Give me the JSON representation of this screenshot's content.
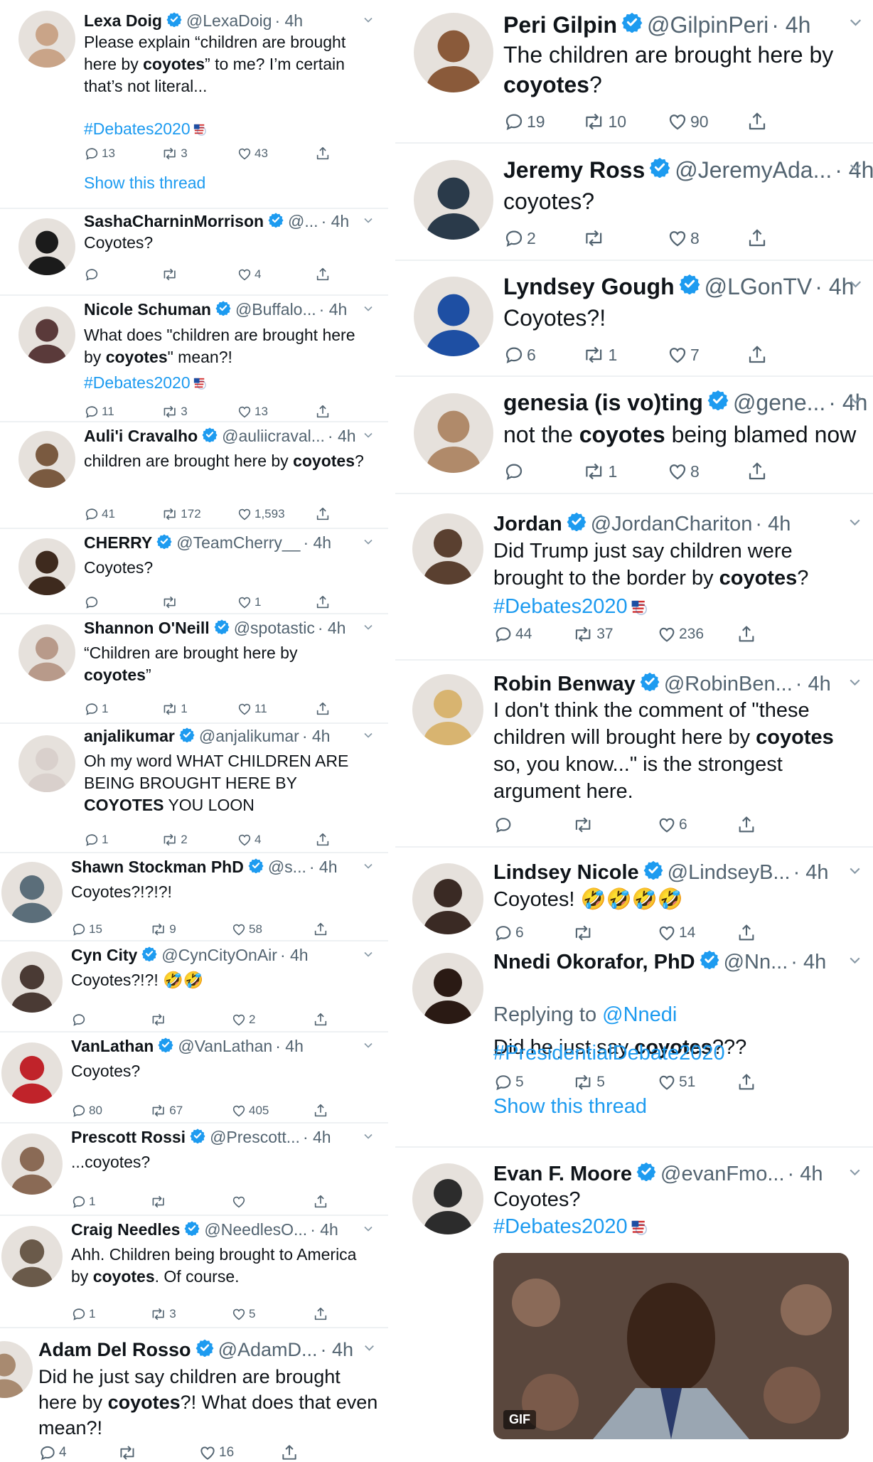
{
  "left": [
    {
      "name": "Lexa Doig",
      "handle": "@LexaDoig",
      "time": "· 4h",
      "pre": "Please explain “children are brought here by ",
      "bold": "coyotes",
      "post": "” to me?  I’m certain that’s not literal...",
      "hashtag": "#Debates2020",
      "reply": "13",
      "rt": "3",
      "like": "43",
      "show": "Show this thread"
    },
    {
      "name": "SashaCharninMorrison",
      "handle": "@...",
      "time": "· 4h",
      "pre": "Coyotes?",
      "bold": "",
      "post": "",
      "reply": "",
      "rt": "",
      "like": "4"
    },
    {
      "name": "Nicole Schuman",
      "handle": "@Buffalo...",
      "time": "· 4h",
      "pre": "What does \"children are brought here by ",
      "bold": "coyotes",
      "post": "\" mean?!",
      "hashtag": "#Debates2020",
      "reply": "11",
      "rt": "3",
      "like": "13"
    },
    {
      "name": "Auli'i Cravalho",
      "handle": "@auliicraval...",
      "time": "· 4h",
      "pre": "children are brought here by ",
      "bold": "coyotes",
      "post": "?",
      "reply": "41",
      "rt": "172",
      "like": "1,593"
    },
    {
      "name": "CHERRY",
      "handle": "@TeamCherry__",
      "time": "· 4h",
      "pre": "Coyotes?",
      "bold": "",
      "post": "",
      "reply": "",
      "rt": "",
      "like": "1"
    },
    {
      "name": "Shannon O'Neill",
      "handle": "@spotastic",
      "time": "· 4h",
      "pre": "“Children are brought here by ",
      "bold": "coyotes",
      "post": "”",
      "reply": "1",
      "rt": "1",
      "like": "11"
    },
    {
      "name": "anjalikumar",
      "handle": "@anjalikumar",
      "time": "· 4h",
      "pre": "Oh my word WHAT CHILDREN ARE BEING BROUGHT HERE BY ",
      "bold": "COYOTES",
      "post": " YOU LOON",
      "reply": "1",
      "rt": "2",
      "like": "4"
    },
    {
      "name": "Shawn Stockman PhD",
      "handle": "@s...",
      "time": "· 4h",
      "pre": "Coyotes?!?!?!",
      "bold": "",
      "post": "",
      "reply": "15",
      "rt": "9",
      "like": "58"
    },
    {
      "name": "Cyn City",
      "handle": "@CynCityOnAir",
      "time": "· 4h",
      "pre": "Coyotes?!?! ",
      "bold": "",
      "post": "",
      "emoji": "🤣🤣",
      "reply": "",
      "rt": "",
      "like": "2"
    },
    {
      "name": "VanLathan",
      "handle": "@VanLathan",
      "time": "· 4h",
      "pre": "Coyotes?",
      "bold": "",
      "post": "",
      "reply": "80",
      "rt": "67",
      "like": "405"
    },
    {
      "name": "Prescott Rossi",
      "handle": "@Prescott...",
      "time": "· 4h",
      "pre": "...coyotes?",
      "bold": "",
      "post": "",
      "reply": "1",
      "rt": "",
      "like": ""
    },
    {
      "name": "Craig Needles",
      "handle": "@NeedlesO...",
      "time": "· 4h",
      "pre": "Ahh. Children being brought to America by ",
      "bold": "coyotes",
      "post": ". Of course.",
      "reply": "1",
      "rt": "3",
      "like": "5"
    },
    {
      "name": "Adam Del Rosso",
      "handle": "@AdamD...",
      "time": "· 4h",
      "pre": "Did he just say children are brought here by ",
      "bold": "coyotes",
      "post": "?! What does that even mean?!",
      "reply": "4",
      "rt": "",
      "like": "16"
    }
  ],
  "right": [
    {
      "name": "Peri Gilpin",
      "handle": "@GilpinPeri",
      "time": "· 4h",
      "pre": "The children are brought here by ",
      "bold": "coyotes",
      "post": "?",
      "reply": "19",
      "rt": "10",
      "like": "90"
    },
    {
      "name": "Jeremy Ross",
      "handle": "@JeremyAda...",
      "time": "· 4h",
      "pre": "coyotes?",
      "bold": "",
      "post": "",
      "reply": "2",
      "rt": "",
      "like": "8"
    },
    {
      "name": "Lyndsey Gough",
      "handle": "@LGonTV",
      "time": "· 4h",
      "pre": "Coyotes?!",
      "bold": "",
      "post": "",
      "reply": "6",
      "rt": "1",
      "like": "7"
    },
    {
      "name": "genesia (is vo)ting",
      "handle": "@gene...",
      "time": "· 4h",
      "pre": "not the ",
      "bold": "coyotes",
      "post": " being blamed now",
      "reply": "",
      "rt": "1",
      "like": "8"
    },
    {
      "name": "Jordan",
      "handle": "@JordanChariton",
      "time": "· 4h",
      "pre": "Did Trump just say children were brought to the border by ",
      "bold": "coyotes",
      "post": "?",
      "hashtag": "#Debates2020",
      "reply": "44",
      "rt": "37",
      "like": "236"
    },
    {
      "name": "Robin Benway",
      "handle": "@RobinBen...",
      "time": "· 4h",
      "pre": "I don't think the comment of \"these children will brought here by ",
      "bold": "coyotes",
      "post": " so, you know...\" is the strongest argument here.",
      "reply": "",
      "rt": "",
      "like": "6"
    },
    {
      "name": "Lindsey Nicole",
      "handle": "@LindseyB...",
      "time": "· 4h",
      "pre": "Coyotes! ",
      "bold": "",
      "post": "",
      "emoji": "🤣🤣🤣🤣",
      "reply": "6",
      "rt": "",
      "like": "14"
    },
    {
      "name": "Nnedi Okorafor, PhD",
      "handle": "@Nn...",
      "time": "· 4h",
      "replying": "Replying to ",
      "replying_handle": "@Nnedi",
      "pre": "Did he just say ",
      "bold": "coyotes",
      "post": "???",
      "hashtag": "#PresidentialDebate2020",
      "reply": "5",
      "rt": "5",
      "like": "51",
      "show": "Show this thread"
    },
    {
      "name": "Evan F. Moore",
      "handle": "@evanFmo...",
      "time": "· 4h",
      "pre": "Coyotes?",
      "bold": "",
      "post": "",
      "hashtag": "#Debates2020",
      "gif_badge": "GIF"
    }
  ],
  "colors": {
    "accent": "#1d9bf0",
    "text": "#0f1419",
    "muted": "#536471",
    "verified": "#1d9bf0",
    "separator": "#eef1f3"
  }
}
